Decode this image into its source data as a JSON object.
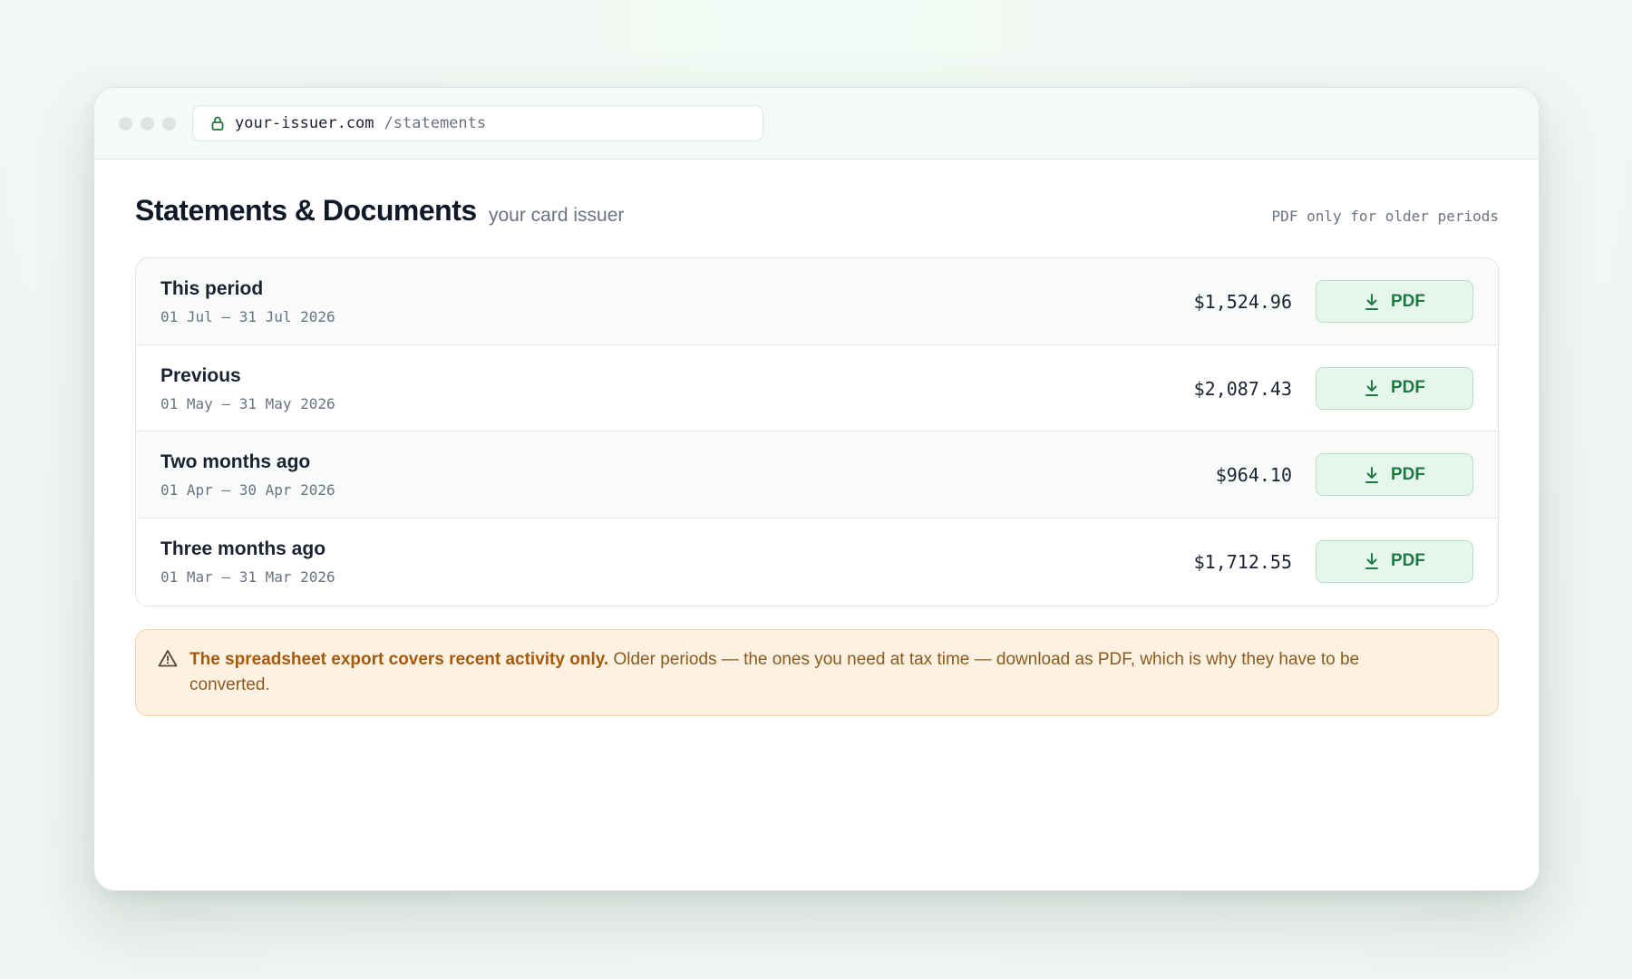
{
  "browser": {
    "url_host": "your-issuer.com",
    "url_path": "/statements"
  },
  "page": {
    "title": "Statements & Documents",
    "subtitle": "your card issuer",
    "note": "PDF only for older periods"
  },
  "statements": [
    {
      "label": "This period",
      "dates": "01 Jul – 31 Jul 2026",
      "amount": "$1,524.96",
      "button": "PDF"
    },
    {
      "label": "Previous",
      "dates": "01 May – 31 May 2026",
      "amount": "$2,087.43",
      "button": "PDF"
    },
    {
      "label": "Two months ago",
      "dates": "01 Apr – 30 Apr 2026",
      "amount": "$964.10",
      "button": "PDF"
    },
    {
      "label": "Three months ago",
      "dates": "01 Mar – 31 Mar 2026",
      "amount": "$1,712.55",
      "button": "PDF"
    }
  ],
  "warning": {
    "strong": "The spreadsheet export covers recent activity only.",
    "text": " Older periods — the ones you need at tax time — download as PDF, which is why they have to be converted."
  },
  "colors": {
    "accent_green": "#1e7a43",
    "button_bg": "#e7f6ec",
    "warning_bg": "#fdf1e2",
    "warning_text": "#a45a0c"
  },
  "icons": {
    "lock": "lock-icon",
    "download": "download-icon",
    "warning": "warning-icon"
  }
}
